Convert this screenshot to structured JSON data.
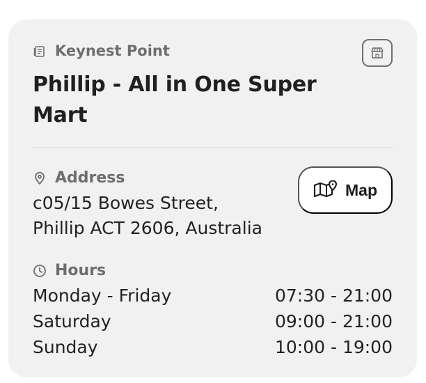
{
  "card": {
    "location_label": "Keynest Point",
    "store_icon": "store-icon",
    "location_icon": "document-icon",
    "title": " Phillip - All in One Super Mart"
  },
  "address": {
    "label": "Address",
    "icon": "map-pin-icon",
    "line1": "c05/15 Bowes Street,",
    "line2": "Phillip ACT 2606, Australia"
  },
  "map_button": {
    "label": "Map",
    "icon": "map-icon"
  },
  "hours": {
    "label": "Hours",
    "icon": "clock-icon",
    "rows": [
      {
        "day": "Monday - Friday",
        "time": "07:30 - 21:00"
      },
      {
        "day": "Saturday",
        "time": "09:00 - 21:00"
      },
      {
        "day": "Sunday",
        "time": "10:00 - 19:00"
      }
    ]
  },
  "colors": {
    "card_background": "#f1f1f1",
    "muted_text": "#6e6e6e",
    "main_text": "#202020",
    "button_background": "#ffffff"
  }
}
